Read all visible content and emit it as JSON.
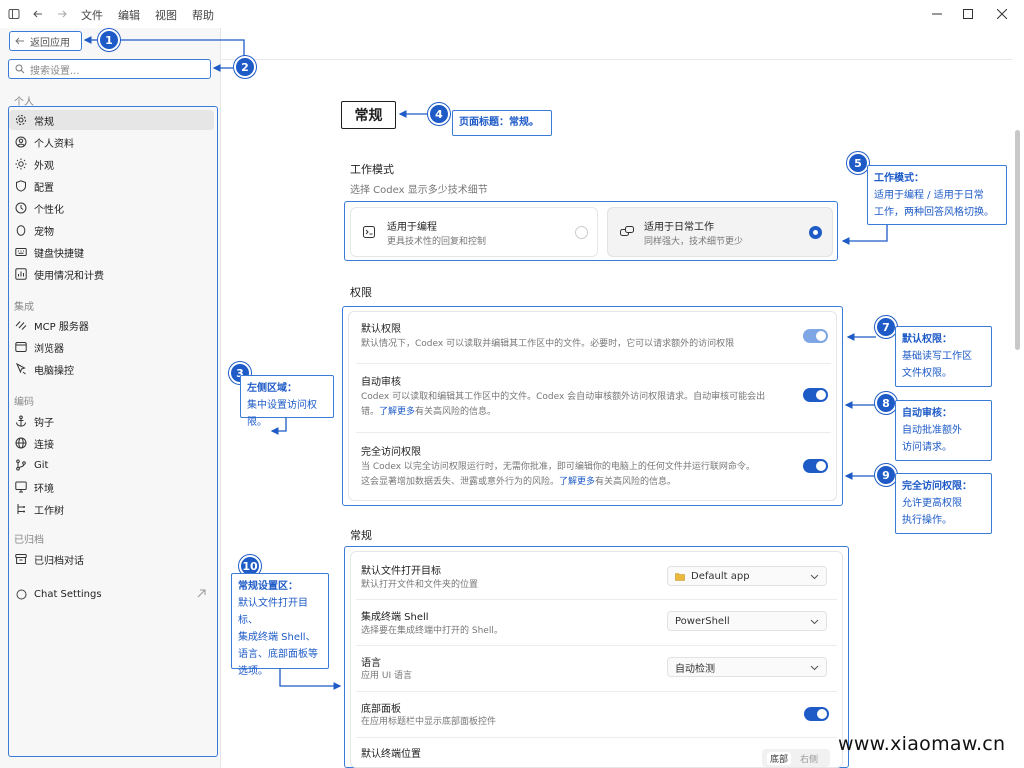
{
  "titlebar": {
    "menus": [
      "文件",
      "编辑",
      "视图",
      "帮助"
    ]
  },
  "sidebar": {
    "back_label": "返回应用",
    "search_placeholder": "搜索设置...",
    "groups": {
      "personal": "个人",
      "integration": "集成",
      "code": "编码",
      "archived": "已归档"
    },
    "personal_items": [
      {
        "label": "常规",
        "icon": "gear-icon"
      },
      {
        "label": "个人资料",
        "icon": "person-icon"
      },
      {
        "label": "外观",
        "icon": "sun-icon"
      },
      {
        "label": "配置",
        "icon": "shield-icon"
      },
      {
        "label": "个性化",
        "icon": "clock-icon"
      },
      {
        "label": "宠物",
        "icon": "egg-icon"
      },
      {
        "label": "键盘快捷键",
        "icon": "keyboard-icon"
      },
      {
        "label": "使用情况和计费",
        "icon": "chart-icon"
      }
    ],
    "integration_items": [
      {
        "label": "MCP 服务器",
        "icon": "mcp-icon"
      },
      {
        "label": "浏览器",
        "icon": "browser-icon"
      },
      {
        "label": "电脑操控",
        "icon": "cursor-icon"
      }
    ],
    "code_items": [
      {
        "label": "钩子",
        "icon": "anchor-icon"
      },
      {
        "label": "连接",
        "icon": "globe-icon"
      },
      {
        "label": "Git",
        "icon": "git-icon"
      },
      {
        "label": "环境",
        "icon": "monitor-icon"
      },
      {
        "label": "工作树",
        "icon": "tree-icon"
      }
    ],
    "archived_items": [
      {
        "label": "已归档对话",
        "icon": "archive-icon"
      }
    ],
    "chat_settings": "Chat Settings"
  },
  "main": {
    "page_title": "常规",
    "work_mode": {
      "title": "工作模式",
      "subtitle": "选择 Codex 显示多少技术细节",
      "options": [
        {
          "title": "适用于编程",
          "desc": "更具技术性的回复和控制",
          "selected": false
        },
        {
          "title": "适用于日常工作",
          "desc": "同样强大，技术细节更少",
          "selected": true
        }
      ]
    },
    "permissions": {
      "title": "权限",
      "rows": [
        {
          "title": "默认权限",
          "desc": "默认情况下，Codex 可以读取并编辑其工作区中的文件。必要时，它可以请求额外的访问权限",
          "on": true
        },
        {
          "title": "自动审核",
          "desc1": "Codex 可以读取和编辑其工作区中的文件。Codex 会自动审核额外访问权限请求。自动审核可能会出",
          "desc2_pre": "错。",
          "link": "了解更多",
          "desc2_post": "有关高风险的信息。",
          "on": true
        },
        {
          "title": "完全访问权限",
          "desc1": "当 Codex 以完全访问权限运行时，无需你批准，即可编辑你的电脑上的任何文件并运行联网命令。",
          "desc2_pre": "这会显著增加数据丢失、泄露或意外行为的风险。",
          "link": "了解更多",
          "desc2_post": "有关高风险的信息。",
          "on": true
        }
      ]
    },
    "general": {
      "title": "常规",
      "rows": [
        {
          "title": "默认文件打开目标",
          "desc": "默认打开文件和文件夹的位置",
          "value": "Default app"
        },
        {
          "title": "集成终端 Shell",
          "desc": "选择要在集成终端中打开的 Shell。",
          "value": "PowerShell"
        },
        {
          "title": "语言",
          "desc": "应用 UI 语言",
          "value": "自动检测"
        },
        {
          "title": "底部面板",
          "desc": "在应用标题栏中显示底部面板控件",
          "on": true
        },
        {
          "title": "默认终端位置",
          "seg": [
            "底部",
            "右侧"
          ]
        }
      ]
    }
  },
  "callouts": {
    "c1": "1",
    "c2": "2",
    "c3": {
      "num": "3",
      "head": "左侧区域：",
      "body": "集中设置访问权限。"
    },
    "c4": {
      "num": "4",
      "text": "页面标题：常规。"
    },
    "c5": {
      "num": "5",
      "head": "工作模式：",
      "l1": "适用于编程 / 适用于日常",
      "l2": "工作，两种回答风格切换。"
    },
    "c7": {
      "num": "7",
      "head": "默认权限：",
      "l1": "基础读写工作区",
      "l2": "文件权限。"
    },
    "c8": {
      "num": "8",
      "head": "自动审核：",
      "l1": "自动批准额外",
      "l2": "访问请求。"
    },
    "c9": {
      "num": "9",
      "head": "完全访问权限：",
      "l1": "允许更高权限",
      "l2": "执行操作。"
    },
    "c10": {
      "num": "10",
      "head": "常规设置区：",
      "l1": "默认文件打开目标、",
      "l2": "集成终端 Shell、",
      "l3": "语言、底部面板等",
      "l4": "选项。"
    }
  },
  "watermark": "www.xiaomaw.cn",
  "colors": {
    "accent": "#1e5bc7",
    "annotation": "#3a7bd5"
  }
}
